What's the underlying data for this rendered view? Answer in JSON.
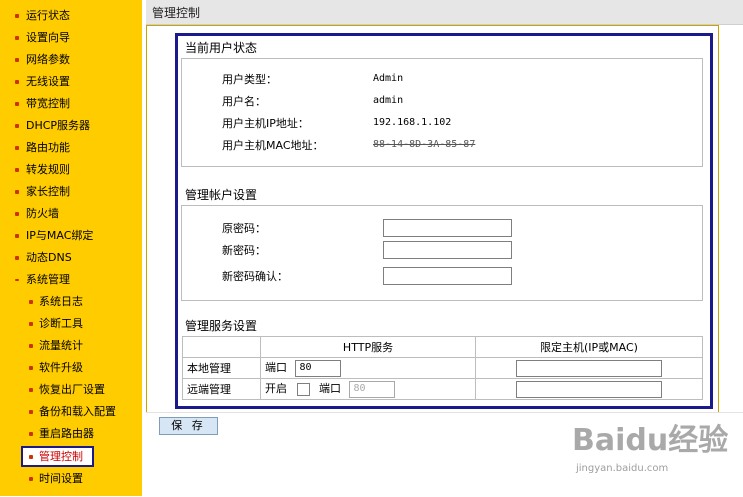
{
  "sidebar": {
    "items": [
      {
        "label": "运行状态"
      },
      {
        "label": "设置向导"
      },
      {
        "label": "网络参数"
      },
      {
        "label": "无线设置"
      },
      {
        "label": "带宽控制"
      },
      {
        "label": "DHCP服务器"
      },
      {
        "label": "路由功能"
      },
      {
        "label": "转发规则"
      },
      {
        "label": "家长控制"
      },
      {
        "label": "防火墙"
      },
      {
        "label": "IP与MAC绑定"
      },
      {
        "label": "动态DNS"
      },
      {
        "label": "系统管理"
      }
    ],
    "subitems": [
      {
        "label": "系统日志"
      },
      {
        "label": "诊断工具"
      },
      {
        "label": "流量统计"
      },
      {
        "label": "软件升级"
      },
      {
        "label": "恢复出厂设置"
      },
      {
        "label": "备份和载入配置"
      },
      {
        "label": "重启路由器"
      },
      {
        "label": "管理控制"
      },
      {
        "label": "时间设置"
      }
    ]
  },
  "header": {
    "title": "管理控制"
  },
  "user_status": {
    "title": "当前用户状态",
    "rows": [
      {
        "label": "用户类型：",
        "value": "Admin"
      },
      {
        "label": "用户名：",
        "value": "admin"
      },
      {
        "label": "用户主机IP地址：",
        "value": "192.168.1.102"
      },
      {
        "label": "用户主机MAC地址：",
        "value": "88-14-8D-3A-85-87"
      }
    ]
  },
  "account": {
    "title": "管理帐户设置",
    "old_pwd_label": "原密码：",
    "new_pwd_label": "新密码：",
    "confirm_label": "新密码确认："
  },
  "service": {
    "title": "管理服务设置",
    "col_http": "HTTP服务",
    "col_host": "限定主机(IP或MAC)",
    "local_label": "本地管理",
    "remote_label": "远端管理",
    "port_label": "端口",
    "enable_label": "开启",
    "local_port": "80",
    "remote_port": "80"
  },
  "save_label": "保 存",
  "watermark": {
    "main": "Baidu经验",
    "sub": "jingyan.baidu.com"
  },
  "colors": {
    "sidebar": "#ffcc00",
    "frame": "#1a1a8c",
    "bullet": "#cc3300"
  }
}
